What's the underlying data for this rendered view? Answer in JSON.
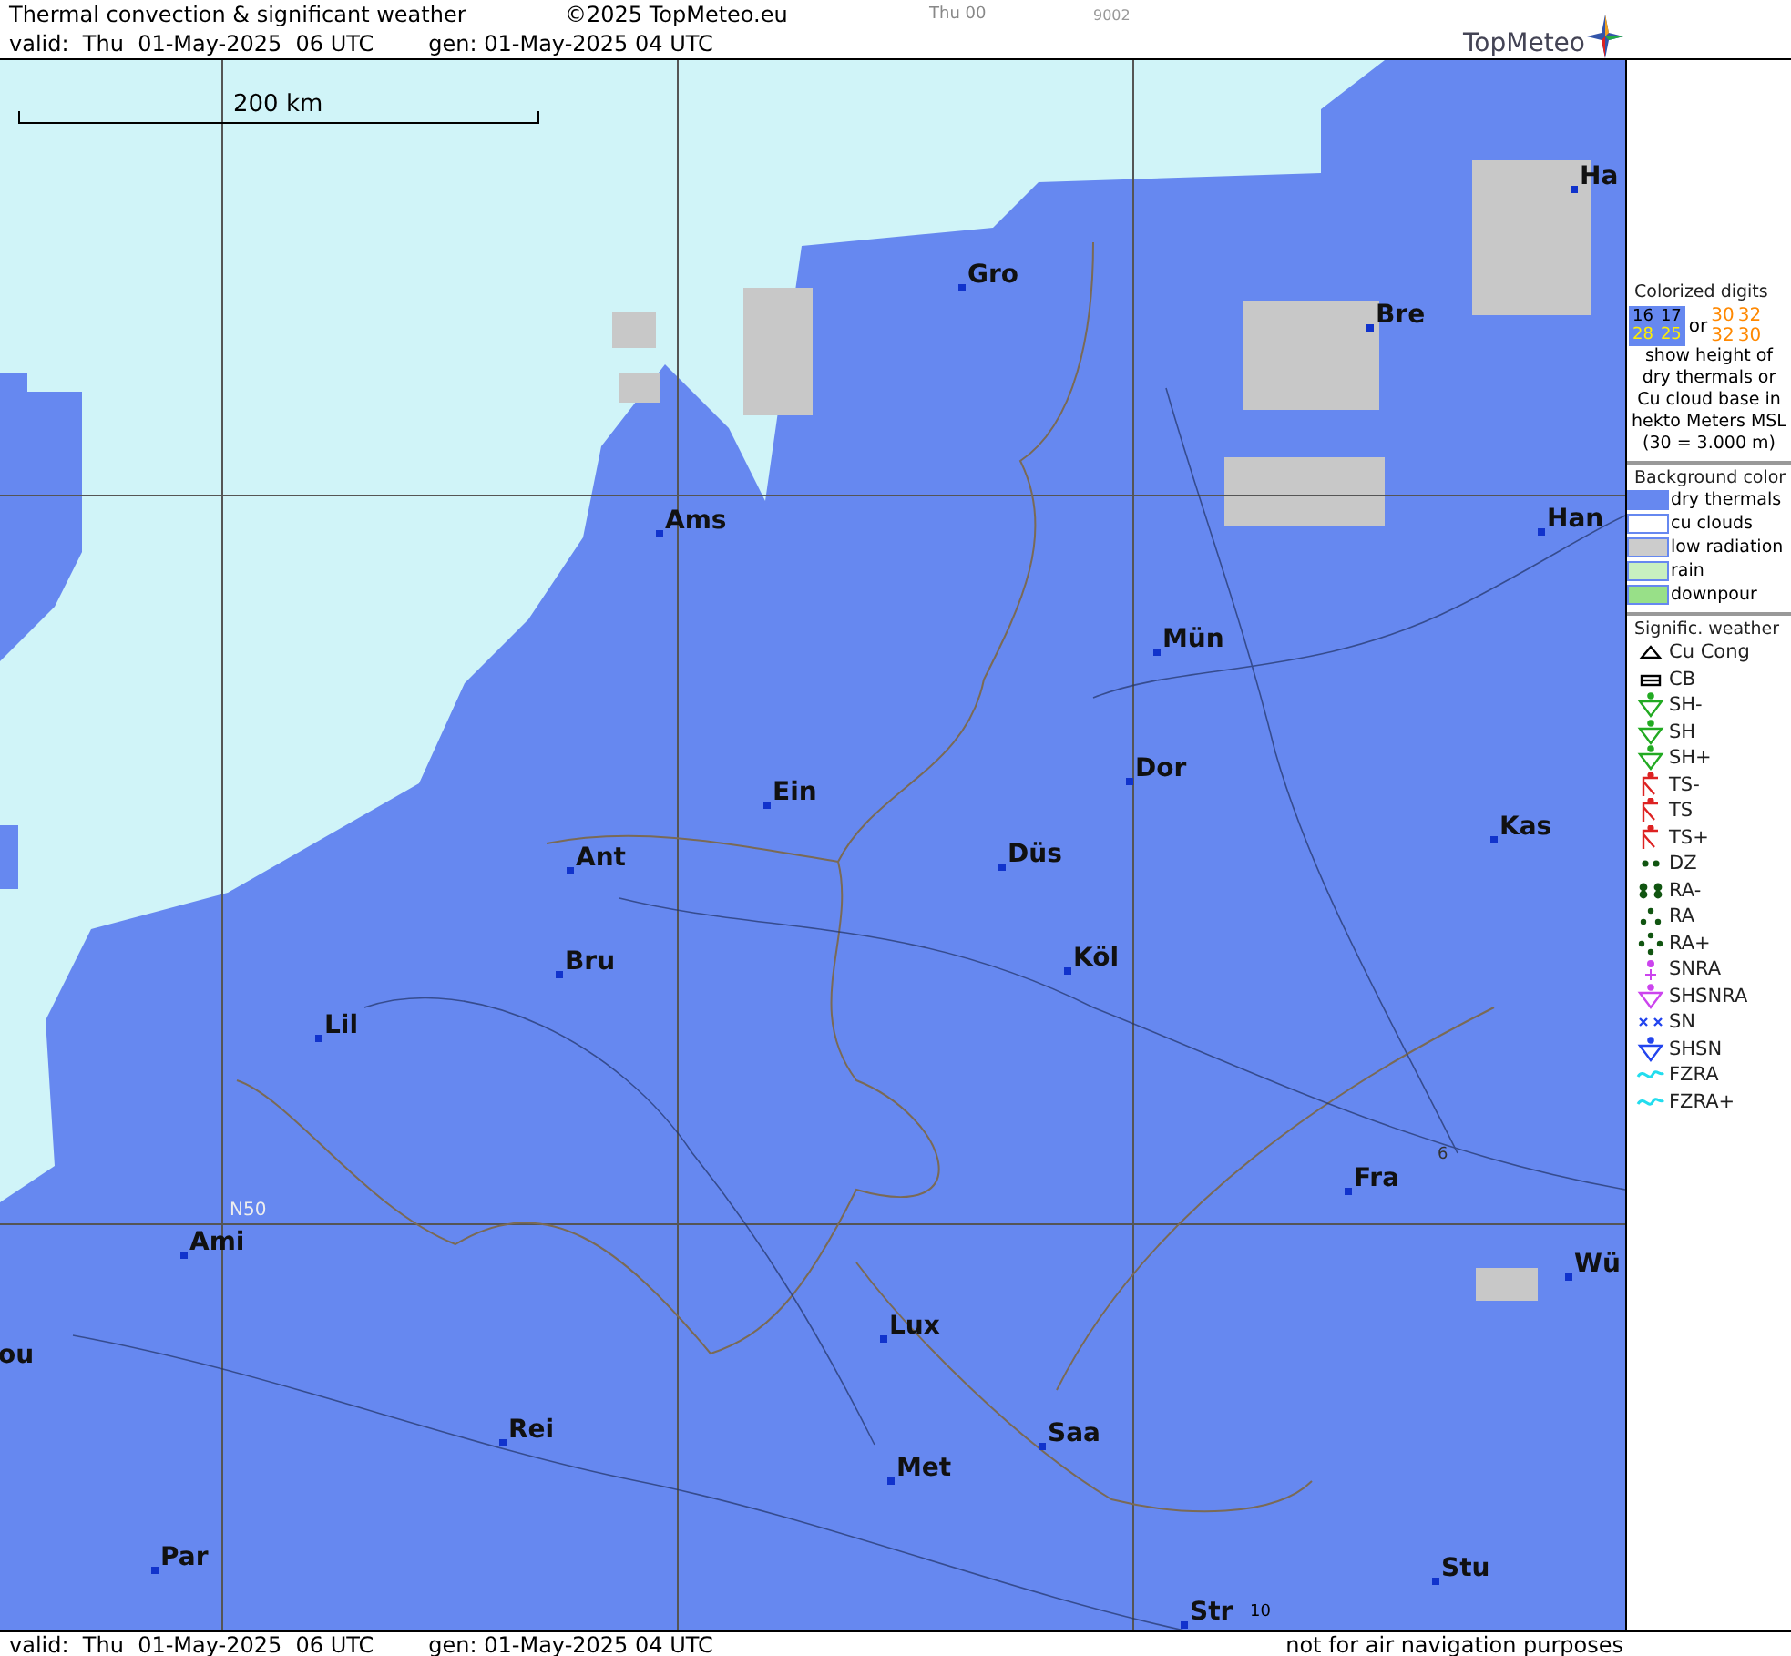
{
  "header": {
    "title": "Thermal convection & significant weather",
    "copyright": "©2025 TopMeteo.eu",
    "run_label": "Thu 00",
    "code": "9002",
    "valid": "valid:  Thu  01-May-2025  06 UTC",
    "generated": "gen: 01-May-2025 04 UTC",
    "logo": "TopMeteo"
  },
  "map": {
    "scale": "200 km",
    "latitude_label": "N50",
    "marks": [
      "6",
      "10"
    ],
    "cities": [
      {
        "name": "Ha"
      },
      {
        "name": "Gro"
      },
      {
        "name": "Bre"
      },
      {
        "name": "Ams"
      },
      {
        "name": "Han"
      },
      {
        "name": "Mün"
      },
      {
        "name": "Dor"
      },
      {
        "name": "Ein"
      },
      {
        "name": "Kas"
      },
      {
        "name": "Düs"
      },
      {
        "name": "Ant"
      },
      {
        "name": "Köl"
      },
      {
        "name": "Bru"
      },
      {
        "name": "Lil"
      },
      {
        "name": "Fra"
      },
      {
        "name": "Ami"
      },
      {
        "name": "Wü"
      },
      {
        "name": "Lux"
      },
      {
        "name": "ou"
      },
      {
        "name": "Rei"
      },
      {
        "name": "Saa"
      },
      {
        "name": "Met"
      },
      {
        "name": "Par"
      },
      {
        "name": "Stu"
      },
      {
        "name": "Str"
      }
    ]
  },
  "legend": {
    "digits_title": "Colorized digits",
    "dry_samples": [
      "16",
      "17",
      "28",
      "25"
    ],
    "or": "or",
    "cu_samples": [
      "30",
      "32",
      "32",
      "30"
    ],
    "description": "show height of dry thermals or Cu cloud base in hekto Meters MSL",
    "example": "(30 = 3.000 m)",
    "background_title": "Background color",
    "backgrounds": [
      {
        "label": "dry thermals",
        "color": "#6688f0"
      },
      {
        "label": "cu clouds",
        "color": "#ffffff"
      },
      {
        "label": "low radiation",
        "color": "#cccccc"
      },
      {
        "label": "rain",
        "color": "#c8f0c0"
      },
      {
        "label": "downpour",
        "color": "#98e088"
      }
    ],
    "weather_title": "Signific. weather",
    "weather": [
      {
        "label": "Cu Cong",
        "kind": "cucong",
        "color": "#000000"
      },
      {
        "label": "CB",
        "kind": "cb",
        "color": "#000000"
      },
      {
        "label": "SH-",
        "kind": "shower",
        "color": "#22aa22"
      },
      {
        "label": "SH",
        "kind": "shower",
        "color": "#22aa22"
      },
      {
        "label": "SH+",
        "kind": "shower",
        "color": "#22aa22"
      },
      {
        "label": "TS-",
        "kind": "thunder",
        "color": "#dd2222"
      },
      {
        "label": "TS",
        "kind": "thunder",
        "color": "#dd2222"
      },
      {
        "label": "TS+",
        "kind": "thunder",
        "color": "#dd2222"
      },
      {
        "label": "DZ",
        "kind": "drizzle",
        "color": "#115511"
      },
      {
        "label": "RA-",
        "kind": "rain2",
        "color": "#115511"
      },
      {
        "label": "RA",
        "kind": "rain3",
        "color": "#115511"
      },
      {
        "label": "RA+",
        "kind": "rain4",
        "color": "#115511"
      },
      {
        "label": "SNRA",
        "kind": "snowrain",
        "color": "#cc44ee"
      },
      {
        "label": "SHSNRA",
        "kind": "shower",
        "color": "#cc44ee"
      },
      {
        "label": "SN",
        "kind": "snow",
        "color": "#2244ee"
      },
      {
        "label": "SHSN",
        "kind": "shower",
        "color": "#2244ee"
      },
      {
        "label": "FZRA",
        "kind": "fzra",
        "color": "#22ddee"
      },
      {
        "label": "FZRA+",
        "kind": "fzra",
        "color": "#22ddee"
      }
    ]
  },
  "footer": {
    "valid": "valid:  Thu  01-May-2025  06 UTC",
    "generated": "gen: 01-May-2025 04 UTC",
    "disclaimer": "not for air navigation purposes"
  }
}
